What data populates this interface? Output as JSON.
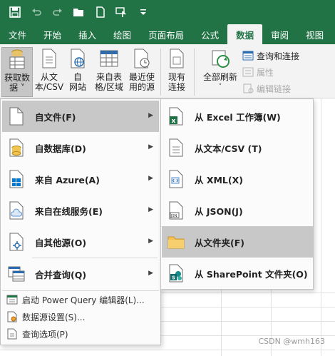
{
  "tabs": [
    "文件",
    "开始",
    "插入",
    "绘图",
    "页面布局",
    "公式",
    "数据",
    "审阅",
    "视图"
  ],
  "active_tab_index": 6,
  "ribbon": {
    "get_data": "获取数\n据",
    "from_text_csv": "从文\n本/CSV",
    "from_web": "自\n网站",
    "from_table": "来自表\n格/区域",
    "recent_sources": "最近使\n用的源",
    "existing_conn": "现有\n连接",
    "refresh_all": "全部刷新",
    "queries_conn": "查询和连接",
    "properties": "属性",
    "edit_links": "编辑链接"
  },
  "menu": {
    "items": [
      {
        "label": "自文件(F)",
        "icon": "file-icon",
        "hover": true
      },
      {
        "label": "自数据库(D)",
        "icon": "database-icon"
      },
      {
        "label": "来自 Azure(A)",
        "icon": "azure-windows-icon"
      },
      {
        "label": "来自在线服务(E)",
        "icon": "cloud-service-icon"
      },
      {
        "label": "自其他源(O)",
        "icon": "other-sources-icon"
      },
      {
        "label": "合并查询(Q)",
        "icon": "combine-queries-icon"
      }
    ],
    "small_items": [
      {
        "label": "启动 Power Query 编辑器(L)..."
      },
      {
        "label": "数据源设置(S)..."
      },
      {
        "label": "查询选项(P)"
      }
    ]
  },
  "submenu": {
    "items": [
      {
        "label": "从 Excel 工作簿(W)",
        "icon": "excel-workbook-icon"
      },
      {
        "label": "从文本/CSV (T)",
        "icon": "text-csv-icon"
      },
      {
        "label": "从 XML(X)",
        "icon": "xml-icon"
      },
      {
        "label": "从 JSON(J)",
        "icon": "json-icon"
      },
      {
        "label": "从文件夹(F)",
        "icon": "folder-icon",
        "hover": true
      },
      {
        "label": "从 SharePoint 文件夹(O)",
        "icon": "sharepoint-icon"
      }
    ]
  },
  "watermark": "CSDN @wmh163",
  "colors": {
    "excel_green": "#217346",
    "hover_gray": "#c8c8c8"
  }
}
